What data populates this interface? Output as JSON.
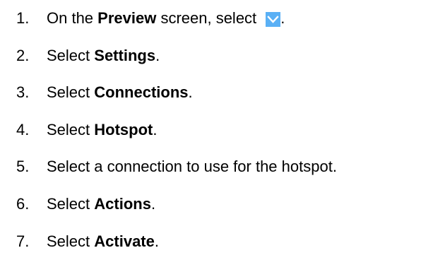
{
  "steps": [
    {
      "number": "1.",
      "before": "On the ",
      "bold": "Preview",
      "after": " screen, select ",
      "icon": "chevron-down-icon",
      "icon_color": "#5ab0f5",
      "end": "."
    },
    {
      "number": "2.",
      "before": "Select ",
      "bold": "Settings",
      "after": "."
    },
    {
      "number": "3.",
      "before": "Select ",
      "bold": "Connections",
      "after": "."
    },
    {
      "number": "4.",
      "before": "Select ",
      "bold": "Hotspot",
      "after": "."
    },
    {
      "number": "5.",
      "before": "Select a connection to use for the hotspot.",
      "bold": "",
      "after": ""
    },
    {
      "number": "6.",
      "before": "Select ",
      "bold": "Actions",
      "after": "."
    },
    {
      "number": "7.",
      "before": "Select ",
      "bold": "Activate",
      "after": "."
    }
  ]
}
